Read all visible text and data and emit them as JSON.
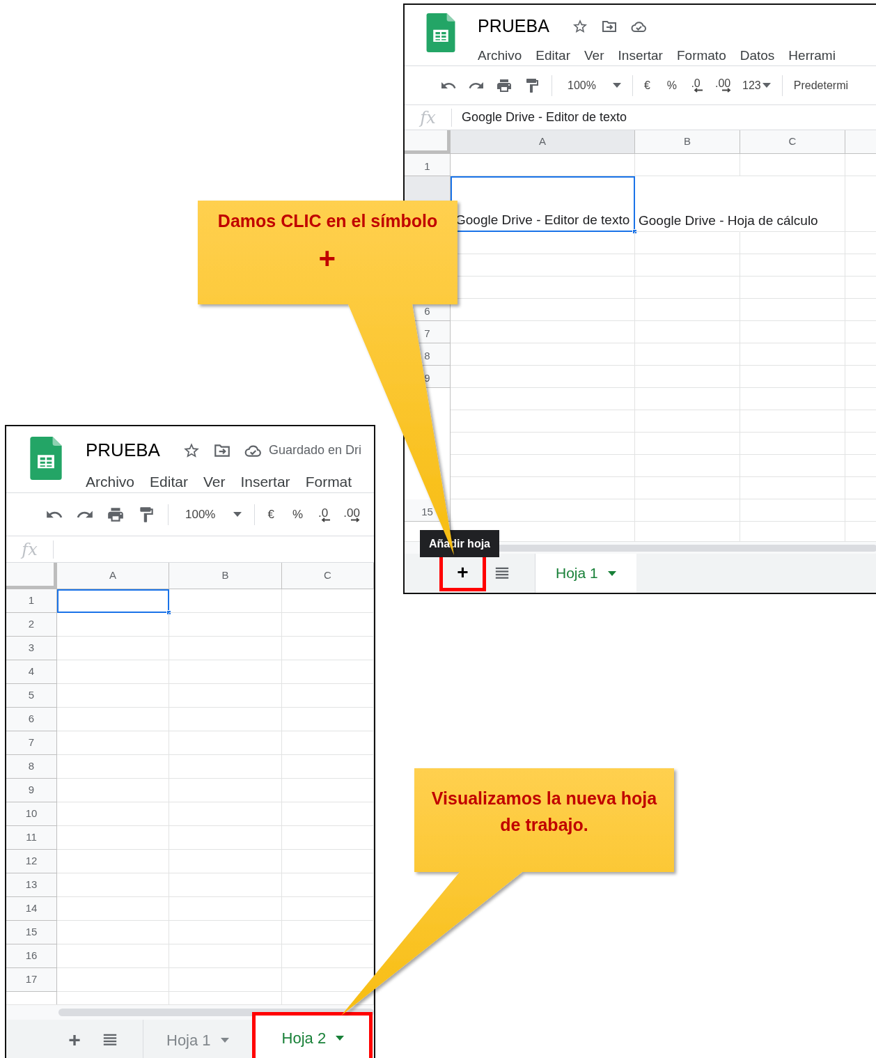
{
  "windows": [
    {
      "title": "PRUEBA",
      "menu": [
        "Archivo",
        "Editar",
        "Ver",
        "Insertar",
        "Formato",
        "Datos",
        "Herrami"
      ],
      "toolbar": {
        "zoom": "100%",
        "currency": "€",
        "percent": "%",
        "decrease_decimals": ".0",
        "increase_decimals": ".00",
        "number_format": "123",
        "font": "Predetermi"
      },
      "formula_bar": {
        "label": "fx",
        "value": "Google Drive - Editor de texto"
      },
      "columns": [
        {
          "label": "A",
          "selected": true
        },
        {
          "label": "B",
          "selected": false
        },
        {
          "label": "C",
          "selected": false
        },
        {
          "selected": false
        }
      ],
      "rows": [
        {
          "label": "1"
        },
        {
          "cells": [
            {
              "text": "Google Drive - Editor de texto",
              "selected": true
            },
            {
              "text": "Google Drive - Hoja de cálculo",
              "selected": false
            }
          ]
        },
        {},
        {},
        {},
        {
          "label": "6"
        },
        {
          "label": "7"
        },
        {
          "label": "8"
        },
        {
          "label": "9"
        },
        {},
        {},
        {},
        {},
        {},
        {
          "label": "15"
        },
        {}
      ],
      "tooltip": "Añadir hoja",
      "add_button": {
        "label": "+",
        "highlighted": true
      },
      "sheets": [
        {
          "label": "Hoja 1",
          "selected": true,
          "highlighted": false
        }
      ]
    },
    {
      "title": "PRUEBA",
      "save_status": "Guardado en Dri",
      "menu": [
        "Archivo",
        "Editar",
        "Ver",
        "Insertar",
        "Format"
      ],
      "toolbar": {
        "zoom": "100%",
        "currency": "€",
        "percent": "%",
        "decrease_decimals": ".0",
        "increase_decimals": ".00"
      },
      "formula_bar": {
        "label": "fx"
      },
      "columns": [
        {
          "label": "A",
          "selected": false
        },
        {
          "label": "B",
          "selected": false
        },
        {
          "label": "C",
          "selected": false
        }
      ],
      "rows": [
        {
          "label": "1",
          "cells": [
            {
              "selected": true
            }
          ]
        },
        {
          "label": "2"
        },
        {
          "label": "3"
        },
        {
          "label": "4"
        },
        {
          "label": "5"
        },
        {
          "label": "6"
        },
        {
          "label": "7"
        },
        {
          "label": "8"
        },
        {
          "label": "9"
        },
        {
          "label": "10"
        },
        {
          "label": "11"
        },
        {
          "label": "12"
        },
        {
          "label": "13"
        },
        {
          "label": "14"
        },
        {
          "label": "15"
        },
        {
          "label": "16"
        },
        {
          "label": "17"
        },
        {}
      ],
      "add_button": {
        "label": "+",
        "highlighted": false
      },
      "sheets": [
        {
          "label": "Hoja 1",
          "selected": false,
          "highlighted": false
        },
        {
          "label": "Hoja 2",
          "selected": true,
          "highlighted": true
        }
      ]
    }
  ],
  "callouts": [
    {
      "text": "Damos CLIC en el símbolo",
      "symbol": "+"
    },
    {
      "text": "Visualizamos la nueva hoja de trabajo."
    }
  ]
}
